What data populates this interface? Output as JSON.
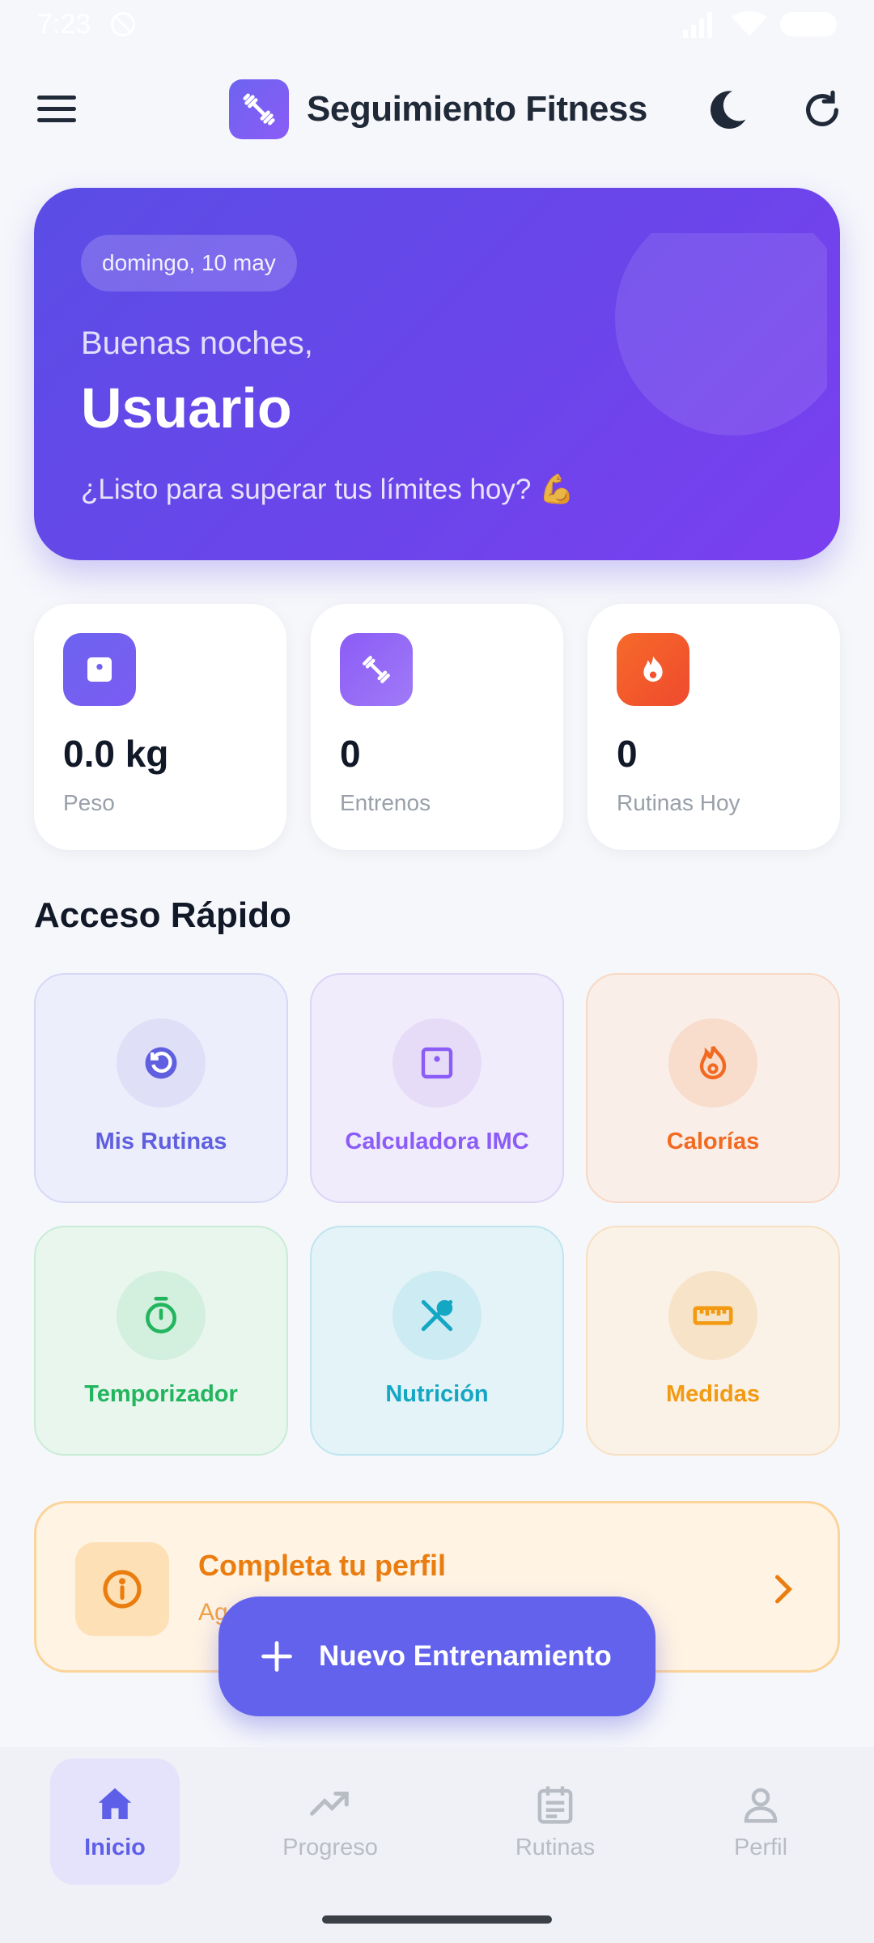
{
  "status_bar": {
    "time": "7:23"
  },
  "app_bar": {
    "title": "Seguimiento Fitness"
  },
  "hero": {
    "date": "domingo, 10 may",
    "greeting": "Buenas noches,",
    "name": "Usuario",
    "motivation": "¿Listo para superar tus límites hoy? 💪"
  },
  "stats": [
    {
      "value": "0.0 kg",
      "label": "Peso",
      "icon": "scale-icon",
      "color": "#7062f0"
    },
    {
      "value": "0",
      "label": "Entrenos",
      "icon": "dumbbell-icon",
      "color": "#8b5cf6"
    },
    {
      "value": "0",
      "label": "Rutinas Hoy",
      "icon": "fire-icon",
      "color": "#f4512c"
    }
  ],
  "quick_access": {
    "title": "Acceso Rápido",
    "tiles": [
      {
        "label": "Mis Rutinas",
        "icon": "history-icon",
        "color": "#5f5fe0",
        "bg": "#eceefb",
        "border": "#d6d8f7",
        "circle": "#dfe0f8"
      },
      {
        "label": "Calculadora IMC",
        "icon": "scale-icon",
        "color": "#8b5cf6",
        "bg": "#f0ecfb",
        "border": "#ddd4f6",
        "circle": "#e6dcf8"
      },
      {
        "label": "Calorías",
        "icon": "fire-icon",
        "color": "#f26a22",
        "bg": "#faeee8",
        "border": "#f7d8c6",
        "circle": "#f8dccc"
      },
      {
        "label": "Temporizador",
        "icon": "timer-icon",
        "color": "#22b55e",
        "bg": "#e8f6ee",
        "border": "#c8ecd6",
        "circle": "#d3efdd"
      },
      {
        "label": "Nutrición",
        "icon": "utensils-icon",
        "color": "#14a7c4",
        "bg": "#e3f3f8",
        "border": "#bfe5ef",
        "circle": "#cdebf2"
      },
      {
        "label": "Medidas",
        "icon": "ruler-icon",
        "color": "#f29b12",
        "bg": "#faf1e7",
        "border": "#f7e0c2",
        "circle": "#f7e3c8"
      }
    ]
  },
  "profile_banner": {
    "title": "Completa tu perfil",
    "subtitle": "Ag"
  },
  "fab": {
    "label": "Nuevo Entrenamiento"
  },
  "bottom_nav": [
    {
      "label": "Inicio",
      "icon": "home-icon",
      "active": true
    },
    {
      "label": "Progreso",
      "icon": "trending-up-icon",
      "active": false
    },
    {
      "label": "Rutinas",
      "icon": "calendar-icon",
      "active": false
    },
    {
      "label": "Perfil",
      "icon": "user-icon",
      "active": false
    }
  ]
}
